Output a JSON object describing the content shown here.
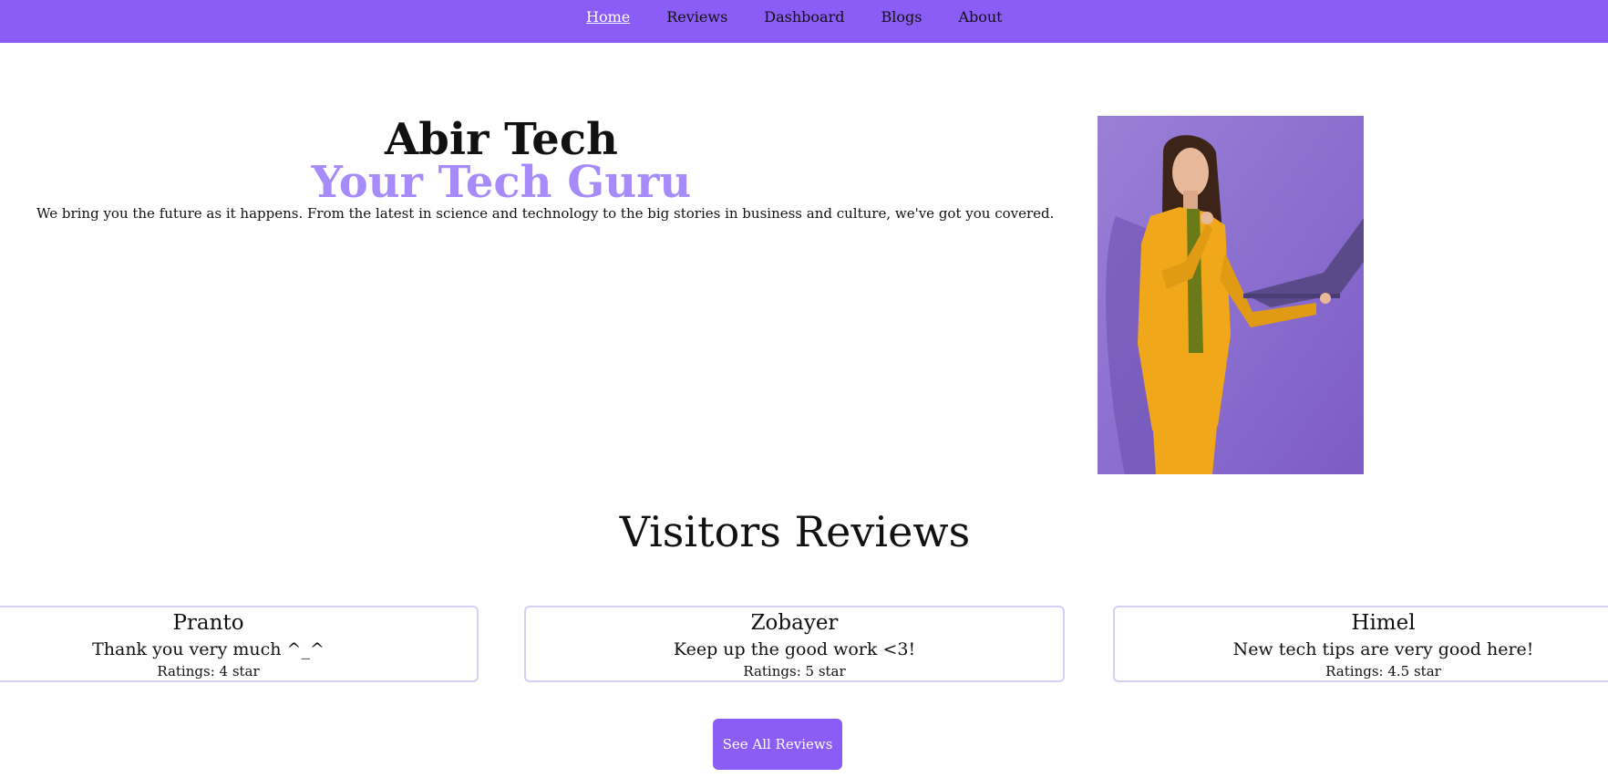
{
  "nav": {
    "items": [
      {
        "label": "Home",
        "active": true
      },
      {
        "label": "Reviews"
      },
      {
        "label": "Dashboard"
      },
      {
        "label": "Blogs"
      },
      {
        "label": "About"
      }
    ]
  },
  "hero": {
    "title": "Abir Tech",
    "subtitle": "Your Tech Guru",
    "description": "We bring you the future as it happens. From the latest in science and technology to the big stories in business and culture, we've got you covered.",
    "image_icon": "woman-with-laptop-photo"
  },
  "reviews": {
    "title": "Visitors Reviews",
    "items": [
      {
        "name": "Pranto",
        "text": "Thank you very much ^_^",
        "rating": "Ratings: 4 star"
      },
      {
        "name": "Zobayer",
        "text": "Keep up the good work <3!",
        "rating": "Ratings: 5 star"
      },
      {
        "name": "Himel",
        "text": "New tech tips are very good here!",
        "rating": "Ratings: 4.5 star"
      }
    ],
    "button_label": "See All Reviews"
  },
  "colors": {
    "accent": "#8b5cf6",
    "subtitle": "#a78bfa",
    "card_border": "#d4d0f5"
  }
}
